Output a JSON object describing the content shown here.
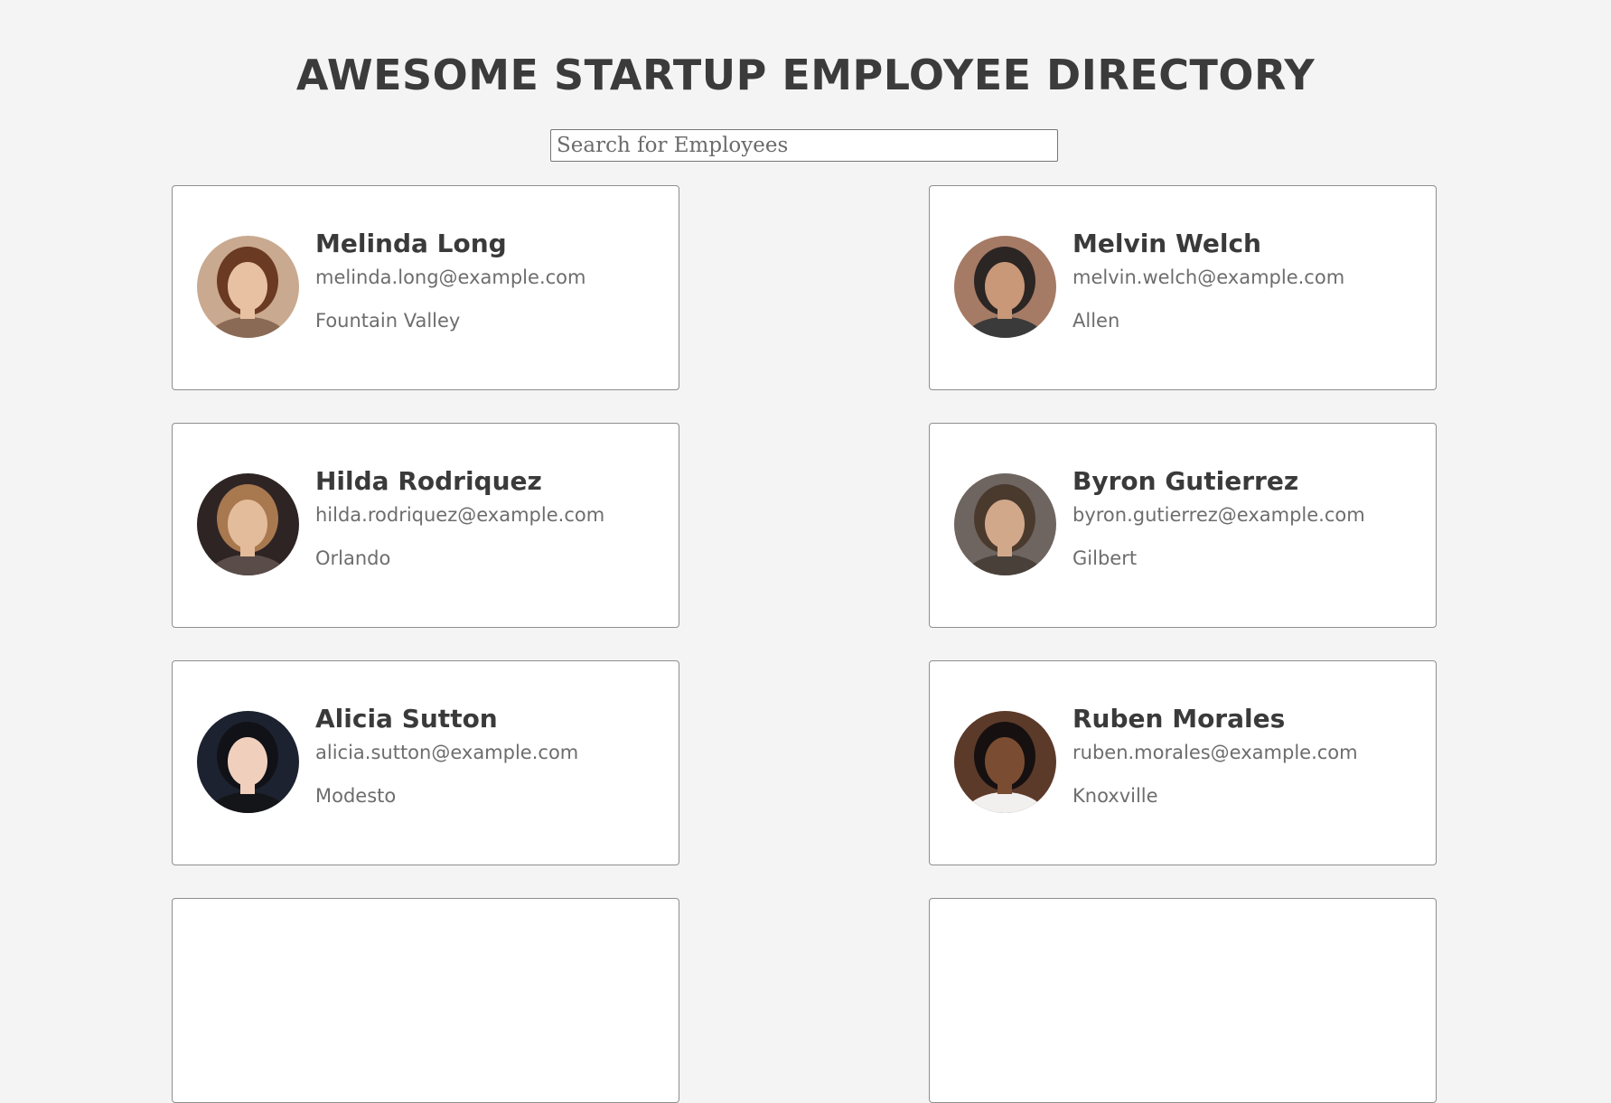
{
  "header": {
    "title": "AWESOME STARTUP EMPLOYEE DIRECTORY"
  },
  "search": {
    "placeholder": "Search for Employees",
    "value": ""
  },
  "employees": [
    {
      "name": "Melinda Long",
      "email": "melinda.long@example.com",
      "location": "Fountain Valley",
      "avatar": {
        "bg": "#c9a98f",
        "hair": "#6b3a22",
        "skin": "#e8c1a2",
        "shirt": "#8a6a55"
      }
    },
    {
      "name": "Melvin Welch",
      "email": "melvin.welch@example.com",
      "location": "Allen",
      "avatar": {
        "bg": "#a57b66",
        "hair": "#2b2523",
        "skin": "#c99878",
        "shirt": "#3a3a3a"
      }
    },
    {
      "name": "Hilda Rodriquez",
      "email": "hilda.rodriquez@example.com",
      "location": "Orlando",
      "avatar": {
        "bg": "#2e2424",
        "hair": "#a8784f",
        "skin": "#e3bc9b",
        "shirt": "#5a4c48"
      }
    },
    {
      "name": "Byron Gutierrez",
      "email": "byron.gutierrez@example.com",
      "location": "Gilbert",
      "avatar": {
        "bg": "#6f6560",
        "hair": "#4a3a2e",
        "skin": "#d2a88b",
        "shirt": "#4a403a"
      }
    },
    {
      "name": "Alicia Sutton",
      "email": "alicia.sutton@example.com",
      "location": "Modesto",
      "avatar": {
        "bg": "#1d2230",
        "hair": "#111217",
        "skin": "#f0d0bd",
        "shirt": "#141518"
      }
    },
    {
      "name": "Ruben Morales",
      "email": "ruben.morales@example.com",
      "location": "Knoxville",
      "avatar": {
        "bg": "#5c3a2a",
        "hair": "#161010",
        "skin": "#7a4d33",
        "shirt": "#f2f0ee"
      }
    },
    {
      "name": "",
      "email": "",
      "location": "",
      "avatar": {
        "bg": "#ffffff",
        "hair": "#ffffff",
        "skin": "#ffffff",
        "shirt": "#ffffff"
      }
    },
    {
      "name": "",
      "email": "",
      "location": "",
      "avatar": {
        "bg": "#ffffff",
        "hair": "#ffffff",
        "skin": "#ffffff",
        "shirt": "#ffffff"
      }
    }
  ]
}
